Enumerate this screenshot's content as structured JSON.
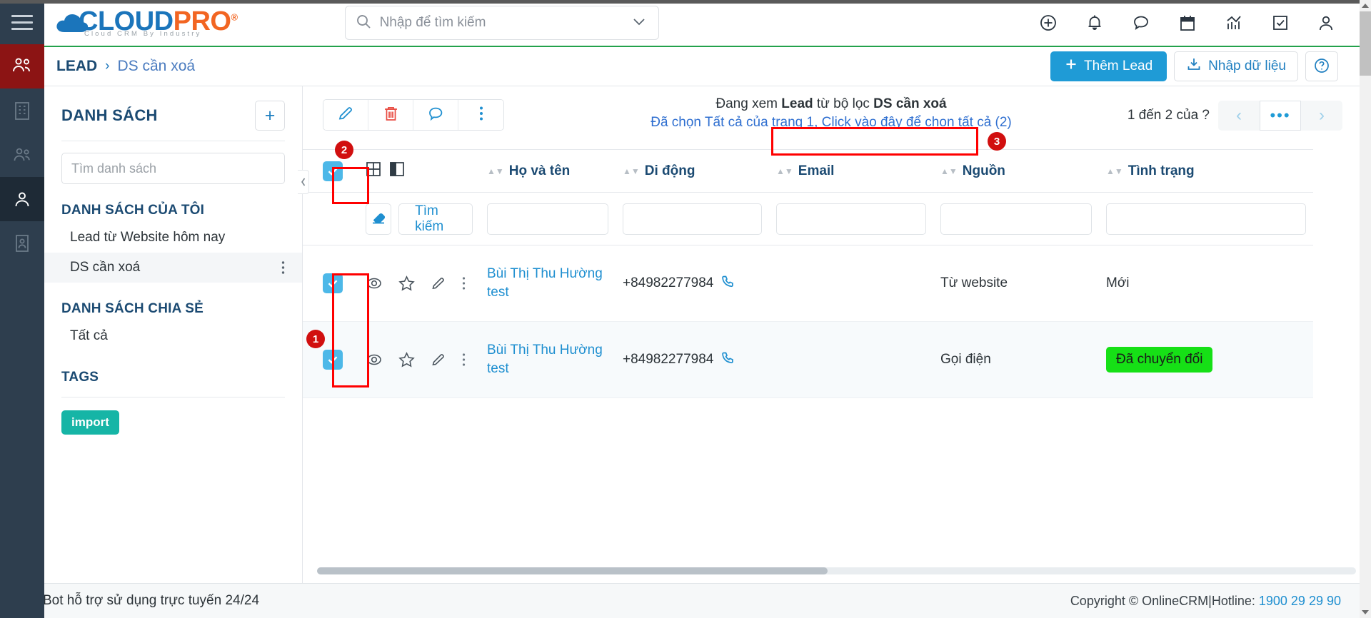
{
  "brand": {
    "name_part1": "CLOUD",
    "name_part2": "PRO",
    "registered": "®",
    "tagline": "Cloud CRM By Industry",
    "accent_blue": "#1b75bb",
    "accent_orange": "#f26522",
    "green_rule": "#23a14b"
  },
  "search": {
    "placeholder": "Nhập để tìm kiếm",
    "value": ""
  },
  "topbar": {
    "icons": [
      "plus-circle-icon",
      "bell-icon",
      "chat-bubble-icon",
      "calendar-icon",
      "chart-icon",
      "checkbox-task-icon",
      "user-account-icon"
    ]
  },
  "breadcrumb": {
    "root": "LEAD",
    "separator": "›",
    "leaf": "DS cần xoá",
    "add_lead_label": "Thêm Lead",
    "import_label": "Nhập dữ liệu",
    "help_label": "?"
  },
  "sidebar_rail": {
    "items": [
      "menu-burger-icon",
      "leads-group-icon",
      "company-icon",
      "contacts-icon",
      "person-active-icon",
      "documents-icon"
    ]
  },
  "list_panel": {
    "title": "DANH SÁCH",
    "add_button": "+",
    "search_placeholder": "Tìm danh sách",
    "search_value": "",
    "groups": [
      {
        "label": "DANH SÁCH CỦA TÔI",
        "items": [
          {
            "label": "Lead từ Website hôm nay",
            "selected": false,
            "kebab": false
          },
          {
            "label": "DS cần xoá",
            "selected": true,
            "kebab": true
          }
        ]
      },
      {
        "label": "DANH SÁCH CHIA SẺ",
        "items": [
          {
            "label": "Tất cả",
            "selected": false,
            "kebab": false
          }
        ]
      }
    ],
    "tags_label": "TAGS",
    "tags": [
      {
        "label": "import",
        "color": "#16b5a6"
      }
    ]
  },
  "toolbar": {
    "buttons": [
      {
        "name": "edit-button",
        "icon": "pencil-icon",
        "color": "#1f8fd0"
      },
      {
        "name": "delete-button",
        "icon": "trash-icon",
        "color": "#e8493f"
      },
      {
        "name": "comment-button",
        "icon": "chat-bubble-icon",
        "color": "#1f8fd0"
      },
      {
        "name": "more-button",
        "icon": "vertical-dots-icon",
        "color": "#1f8fd0"
      }
    ]
  },
  "view_info": {
    "line1_prefix": "Đang xem ",
    "line1_entity": "Lead",
    "line1_middle": " từ bộ lọc ",
    "line1_filter": "DS cần xoá",
    "line2_prefix": "Đã chọn Tất cả của trang 1,",
    "line2_link": "Click vào đây để chọn tất cả (2)"
  },
  "pagination": {
    "range_text": "1 đến 2 của",
    "total": "?",
    "prev": "‹",
    "more": "•••",
    "next": "›"
  },
  "table": {
    "select_all_checked": true,
    "layout_icons": [
      "grid-view-icon",
      "split-view-icon"
    ],
    "columns": [
      {
        "key": "name",
        "label": "Họ và tên"
      },
      {
        "key": "mobile",
        "label": "Di động"
      },
      {
        "key": "email",
        "label": "Email"
      },
      {
        "key": "source",
        "label": "Nguồn"
      },
      {
        "key": "status",
        "label": "Tình trạng"
      }
    ],
    "filter_row": {
      "eraser_icon": "eraser-icon",
      "search_label": "Tìm kiếm",
      "inputs": {
        "name": "",
        "mobile": "",
        "email": "",
        "source": "",
        "status": ""
      }
    },
    "rows": [
      {
        "checked": true,
        "name": "Bùi Thị Thu Hường test",
        "mobile": "+84982277984",
        "email": "",
        "source": "Từ website",
        "status": "Mới",
        "status_badge": false
      },
      {
        "checked": true,
        "name": "Bùi Thị Thu Hường test",
        "mobile": "+84982277984",
        "email": "",
        "source": "Gọi điện",
        "status": "Đã chuyển đổi",
        "status_badge": true,
        "status_color": "#16e016"
      }
    ],
    "row_action_icons": [
      "eye-icon",
      "star-icon",
      "pencil-icon",
      "vertical-dots-icon"
    ]
  },
  "annotations": [
    {
      "number": "1",
      "target": "row-checkboxes"
    },
    {
      "number": "2",
      "target": "select-all-checkbox"
    },
    {
      "number": "3",
      "target": "select-all-link"
    }
  ],
  "footer": {
    "support_text": "Bot hỗ trợ sử dụng trực tuyến 24/24",
    "copyright": "Copyright © OnlineCRM",
    "separator": "|",
    "hotline_label": "Hotline:",
    "hotline_number": "1900 29 29 90"
  }
}
